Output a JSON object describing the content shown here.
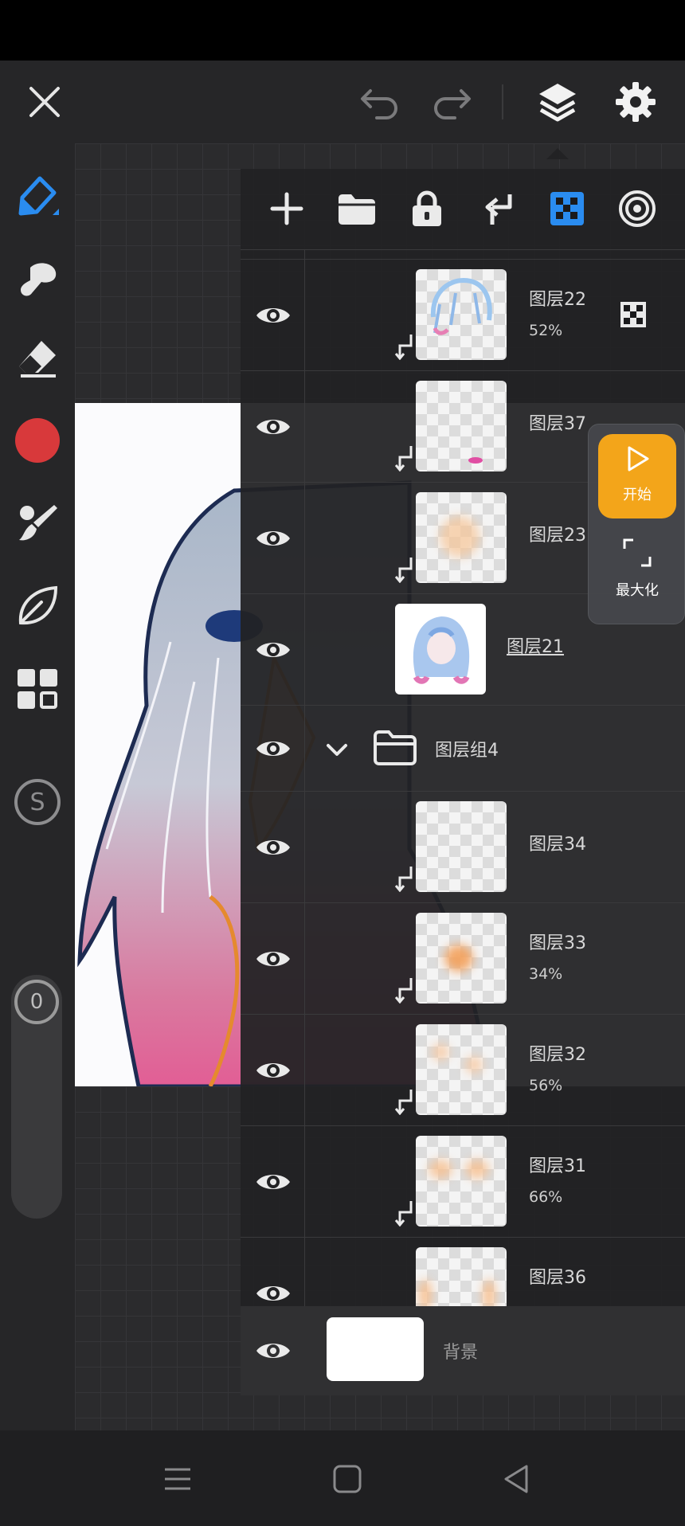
{
  "layers": {
    "items": [
      {
        "name": "图层22",
        "opacity": "52%"
      },
      {
        "name": "图层37",
        "opacity": ""
      },
      {
        "name": "图层23",
        "opacity": ""
      },
      {
        "name": "图层21",
        "opacity": ""
      },
      {
        "name": "图层组4",
        "opacity": ""
      },
      {
        "name": "图层34",
        "opacity": ""
      },
      {
        "name": "图层33",
        "opacity": "34%"
      },
      {
        "name": "图层32",
        "opacity": "56%"
      },
      {
        "name": "图层31",
        "opacity": "66%"
      },
      {
        "name": "图层36",
        "opacity": ""
      }
    ],
    "background": {
      "name": "背景"
    }
  },
  "recorder": {
    "start_label": "开始",
    "maximize_label": "最大化"
  },
  "slider": {
    "value": "0"
  },
  "colors": {
    "accent_blue": "#2a8cf0",
    "brush_color": "#d8393b",
    "record_orange": "#f3a51a"
  },
  "icons": [
    "close-icon",
    "undo-icon",
    "redo-icon",
    "layers-icon",
    "settings-icon",
    "brush-icon",
    "smudge-icon",
    "eraser-icon",
    "color-swatch",
    "brush-settings-icon",
    "leaf-icon",
    "gallery-icon",
    "symmetry-icon",
    "add-layer-icon",
    "folder-icon",
    "lock-icon",
    "clip-icon",
    "alpha-lock-icon",
    "target-icon",
    "eye-icon",
    "play-icon",
    "maximize-icon",
    "menu-icon",
    "home-icon",
    "back-icon"
  ]
}
